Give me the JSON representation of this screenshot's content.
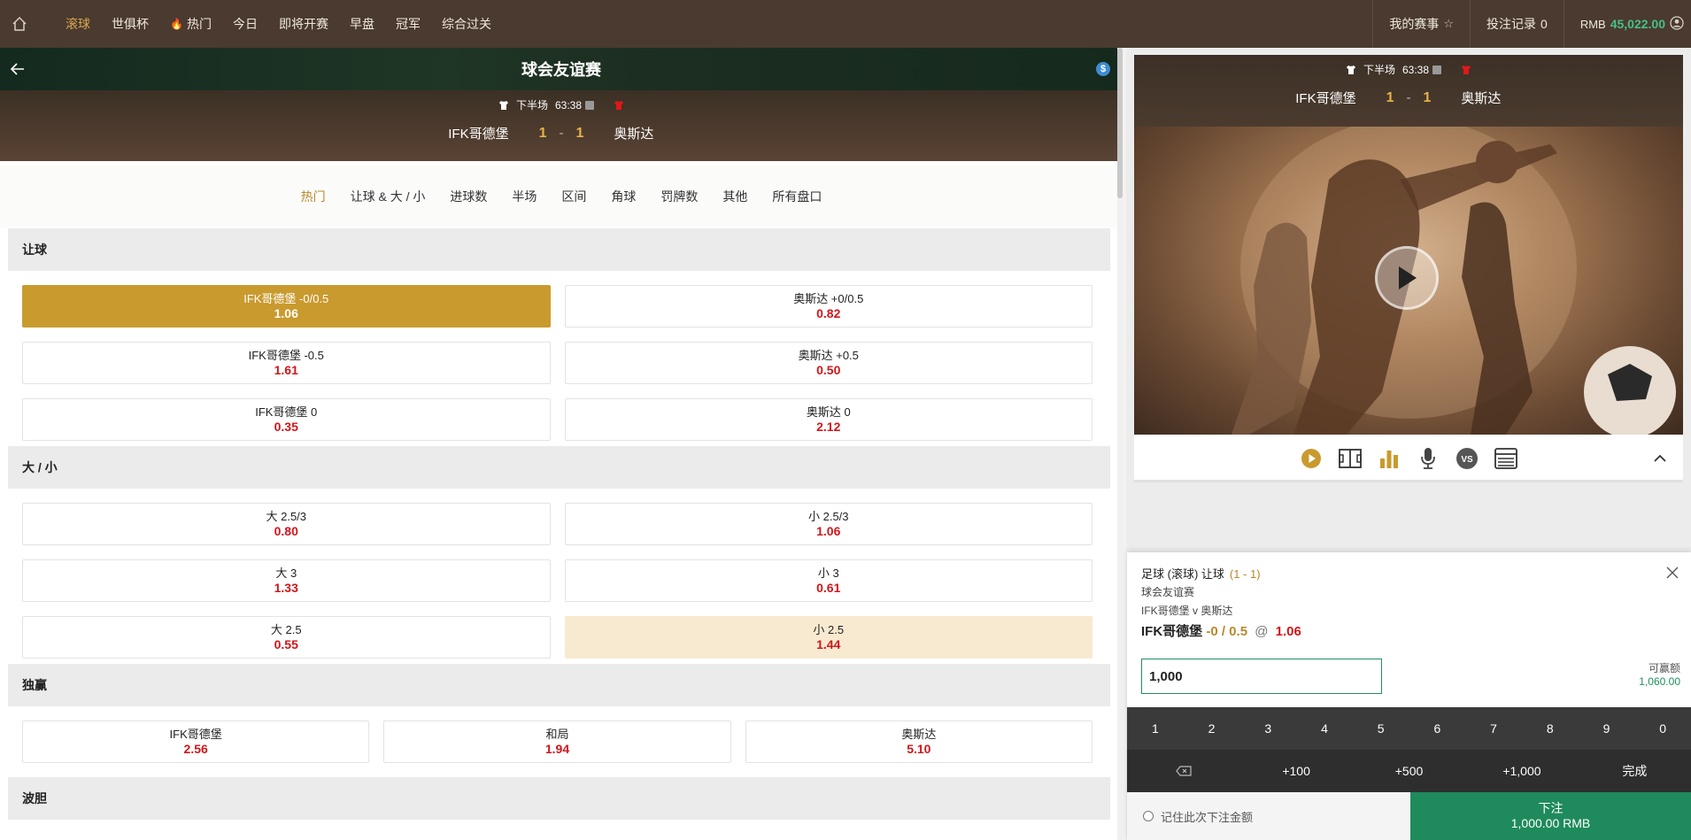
{
  "nav": {
    "items": [
      {
        "label": "滚球",
        "active": true
      },
      {
        "label": "世俱杯"
      },
      {
        "label": "热门",
        "icon": "flame-icon"
      },
      {
        "label": "今日"
      },
      {
        "label": "即将开赛"
      },
      {
        "label": "早盘"
      },
      {
        "label": "冠军"
      },
      {
        "label": "综合过关"
      }
    ],
    "my_events": "我的赛事",
    "bet_record": "投注记录",
    "bet_count": "0",
    "currency": "RMB",
    "balance": "45,022.00"
  },
  "match": {
    "league": "球会友谊赛",
    "period": "下半场",
    "clock": "63:38",
    "home": "IFK哥德堡",
    "away": "奥斯达",
    "home_score": "1",
    "away_score": "1",
    "score_sep": "-"
  },
  "tabs": [
    "热门",
    "让球 & 大 / 小",
    "进球数",
    "半场",
    "区间",
    "角球",
    "罚牌数",
    "其他",
    "所有盘口"
  ],
  "sections": {
    "handicap": {
      "title": "让球",
      "rows": [
        [
          {
            "label": "IFK哥德堡 -0/0.5",
            "odds": "1.06"
          },
          {
            "label": "奥斯达 +0/0.5",
            "odds": "0.82"
          }
        ],
        [
          {
            "label": "IFK哥德堡 -0.5",
            "odds": "1.61"
          },
          {
            "label": "奥斯达 +0.5",
            "odds": "0.50"
          }
        ],
        [
          {
            "label": "IFK哥德堡 0",
            "odds": "0.35"
          },
          {
            "label": "奥斯达 0",
            "odds": "2.12"
          }
        ]
      ]
    },
    "overunder": {
      "title": "大 / 小",
      "rows": [
        [
          {
            "label": "大 2.5/3",
            "odds": "0.80"
          },
          {
            "label": "小 2.5/3",
            "odds": "1.06"
          }
        ],
        [
          {
            "label": "大 3",
            "odds": "1.33"
          },
          {
            "label": "小 3",
            "odds": "0.61"
          }
        ],
        [
          {
            "label": "大 2.5",
            "odds": "0.55"
          },
          {
            "label": "小 2.5",
            "odds": "1.44"
          }
        ]
      ]
    },
    "moneyline": {
      "title": "独赢",
      "items": [
        {
          "label": "IFK哥德堡",
          "odds": "2.56"
        },
        {
          "label": "和局",
          "odds": "1.94"
        },
        {
          "label": "奥斯达",
          "odds": "5.10"
        }
      ]
    },
    "correct_score": {
      "title": "波胆"
    }
  },
  "betslip": {
    "type": "足球 (滚球) 让球",
    "score": "(1 - 1)",
    "league": "球会友谊赛",
    "match": "IFK哥德堡 v 奥斯达",
    "pick_team": "IFK哥德堡",
    "pick_handicap": "-0 / 0.5",
    "at": "@",
    "pick_odds": "1.06",
    "stake": "1,000",
    "win_label": "可赢额",
    "win_value": "1,060.00",
    "keys": [
      "1",
      "2",
      "3",
      "4",
      "5",
      "6",
      "7",
      "8",
      "9",
      "0"
    ],
    "quick": [
      "+100",
      "+500",
      "+1,000"
    ],
    "done": "完成",
    "remember": "记住此次下注金额",
    "place_bet": "下注",
    "place_amount": "1,000.00 RMB"
  },
  "colors": {
    "accent": "#c99a2e",
    "odds_red": "#d0161b",
    "green": "#1f8a5c",
    "nav_bg": "#4a3a2f"
  }
}
